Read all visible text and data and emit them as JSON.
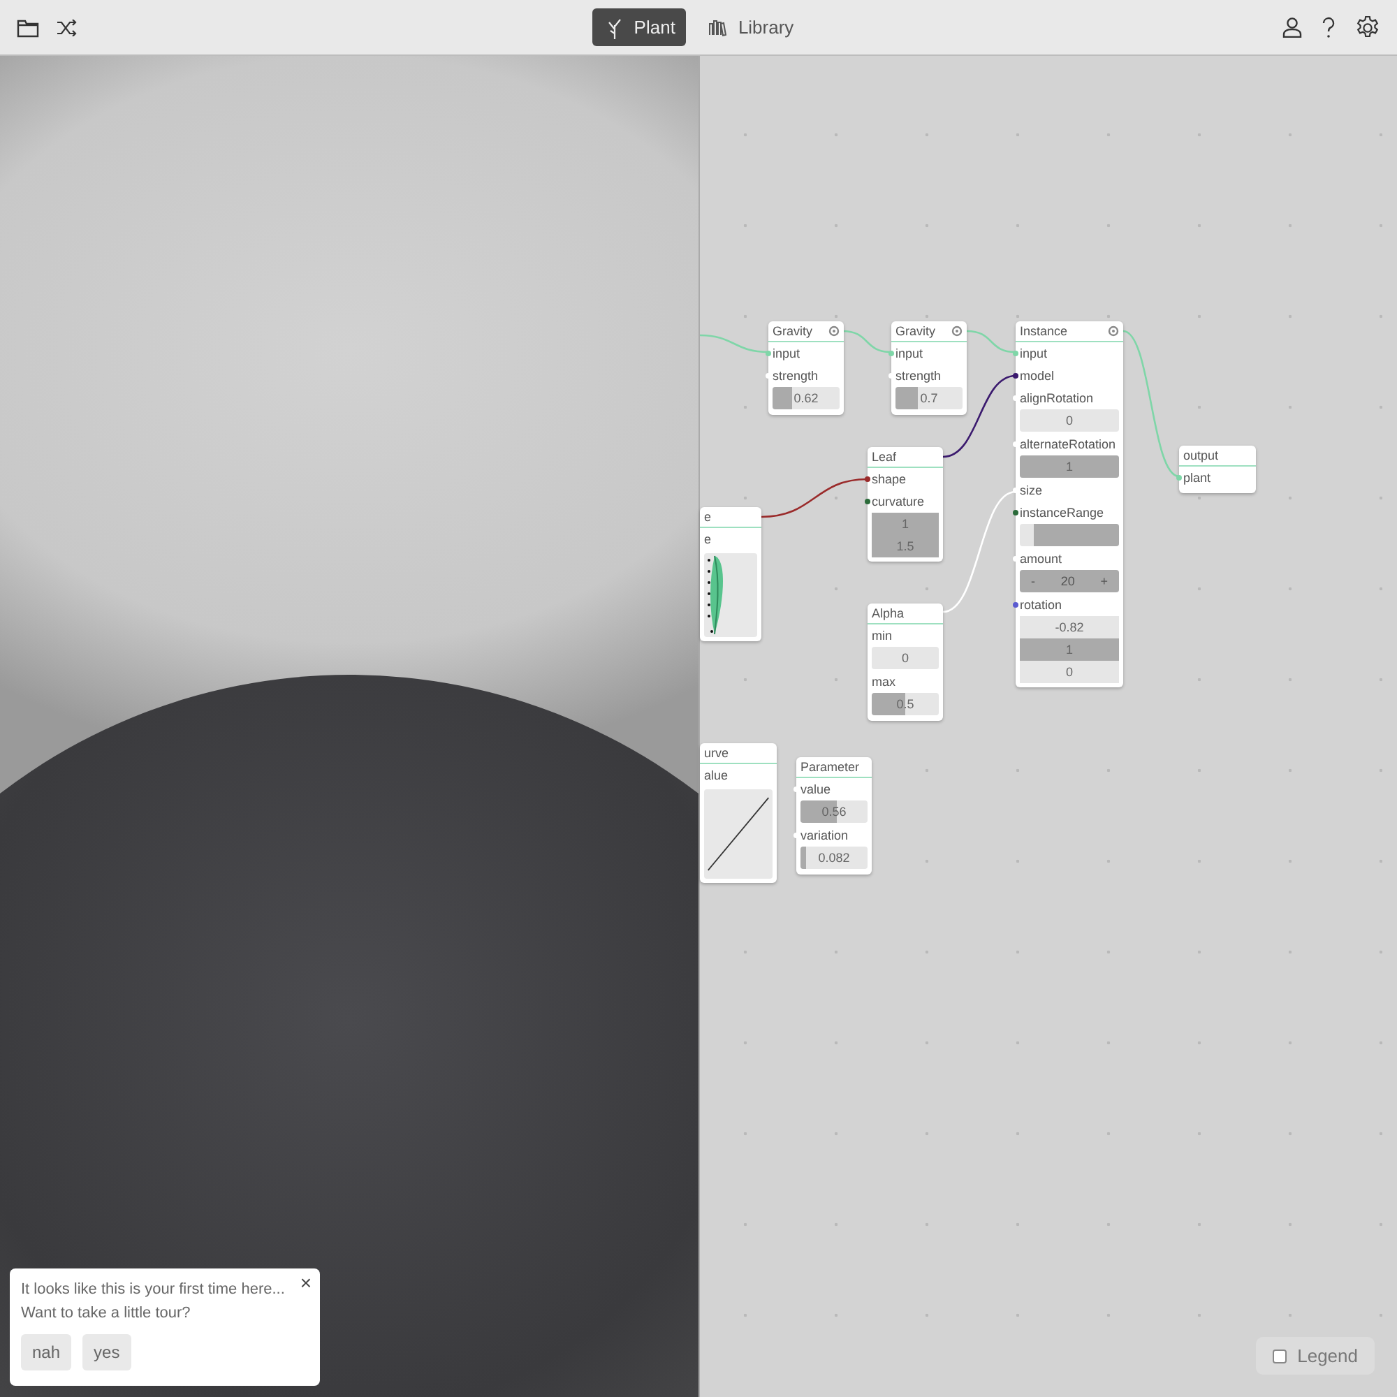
{
  "toolbar": {
    "tabs": [
      {
        "label": "Plant",
        "selected": true,
        "kind": "plant"
      },
      {
        "label": "Library",
        "selected": false,
        "kind": "library"
      }
    ]
  },
  "node_graph": {
    "nodes": [
      {
        "title": "e",
        "gear": false,
        "rows": [
          {
            "kind": "port",
            "label": "e"
          },
          {
            "kind": "leaf_preview"
          }
        ]
      },
      {
        "title": "urve",
        "gear": false,
        "rows": [
          {
            "kind": "port",
            "label": "alue"
          },
          {
            "kind": "curve_preview"
          }
        ]
      },
      {
        "title": "Gravity",
        "gear": true,
        "rows": [
          {
            "kind": "port",
            "label": "input",
            "color": "#7fd6a8"
          },
          {
            "kind": "port",
            "label": "strength",
            "color": "#ffffff"
          },
          {
            "kind": "slider",
            "reading": "0.62",
            "level": 0.3
          }
        ]
      },
      {
        "title": "Parameter",
        "gear": false,
        "rows": [
          {
            "kind": "port",
            "label": "value",
            "color": "#ffffff"
          },
          {
            "kind": "slider",
            "reading": "0.56",
            "level": 0.55
          },
          {
            "kind": "port",
            "label": "variation",
            "color": "#ffffff"
          },
          {
            "kind": "slider",
            "reading": "0.082",
            "level": 0.08
          }
        ]
      },
      {
        "title": "Leaf",
        "gear": false,
        "rows": [
          {
            "kind": "port",
            "label": "shape",
            "color": "#9a2a2a"
          },
          {
            "kind": "port",
            "label": "curvature",
            "color": "#2b6b3a"
          },
          {
            "kind": "vector",
            "items": [
              {
                "reading": "1",
                "level": 1
              },
              {
                "reading": "1.5",
                "level": 1
              }
            ]
          }
        ]
      },
      {
        "title": "Alpha",
        "gear": false,
        "rows": [
          {
            "kind": "port",
            "label": "min"
          },
          {
            "kind": "slider",
            "reading": "0",
            "level": 0
          },
          {
            "kind": "port",
            "label": "max"
          },
          {
            "kind": "slider",
            "reading": "0.5",
            "level": 0.5
          }
        ]
      },
      {
        "title": "Gravity",
        "gear": true,
        "rows": [
          {
            "kind": "port",
            "label": "input",
            "color": "#7fd6a8"
          },
          {
            "kind": "port",
            "label": "strength",
            "color": "#ffffff"
          },
          {
            "kind": "slider",
            "reading": "0.7",
            "level": 0.33
          }
        ]
      },
      {
        "title": "Instance",
        "gear": true,
        "rows": [
          {
            "kind": "port",
            "label": "input",
            "color": "#7fd6a8"
          },
          {
            "kind": "port",
            "label": "model",
            "color": "#3b1a6e"
          },
          {
            "kind": "port",
            "label": "alignRotation",
            "color": "#ffffff"
          },
          {
            "kind": "slider",
            "reading": "0",
            "level": 0
          },
          {
            "kind": "port",
            "label": "alternateRotation",
            "color": "#ffffff"
          },
          {
            "kind": "slider",
            "reading": "1",
            "level": 1
          },
          {
            "kind": "port",
            "label": "size",
            "color": "#ffffff"
          },
          {
            "kind": "port",
            "label": "instanceRange",
            "color": "#2b6b3a"
          },
          {
            "kind": "range",
            "level": 0.86
          },
          {
            "kind": "port",
            "label": "amount",
            "color": "#ffffff"
          },
          {
            "kind": "stepper",
            "minus": "-",
            "reading": "20",
            "plus": "+"
          },
          {
            "kind": "port",
            "label": "rotation",
            "color": "#5b5bd0"
          },
          {
            "kind": "vector",
            "items": [
              {
                "reading": "-0.82",
                "level": 0
              },
              {
                "reading": "1",
                "level": 1
              },
              {
                "reading": "0",
                "level": 0
              }
            ]
          }
        ]
      },
      {
        "title": "output",
        "gear": false,
        "rows": [
          {
            "kind": "port",
            "label": "plant",
            "color": "#7fd6a8"
          }
        ]
      }
    ],
    "edges": [
      {
        "color": "#7fd6a8"
      },
      {
        "color": "#7fd6a8"
      },
      {
        "color": "#7fd6a8"
      },
      {
        "color": "#7fd6a8"
      },
      {
        "color": "#3b1a6e"
      },
      {
        "color": "#9a2a2a"
      },
      {
        "color": "#ffffff"
      }
    ]
  },
  "tour_popup": {
    "lines": [
      "It looks like this is your first time here...",
      "Want to take a little tour?"
    ],
    "close": "×",
    "buttons": [
      "nah",
      "yes"
    ]
  },
  "legend": {
    "label": "Legend",
    "checked": false
  }
}
